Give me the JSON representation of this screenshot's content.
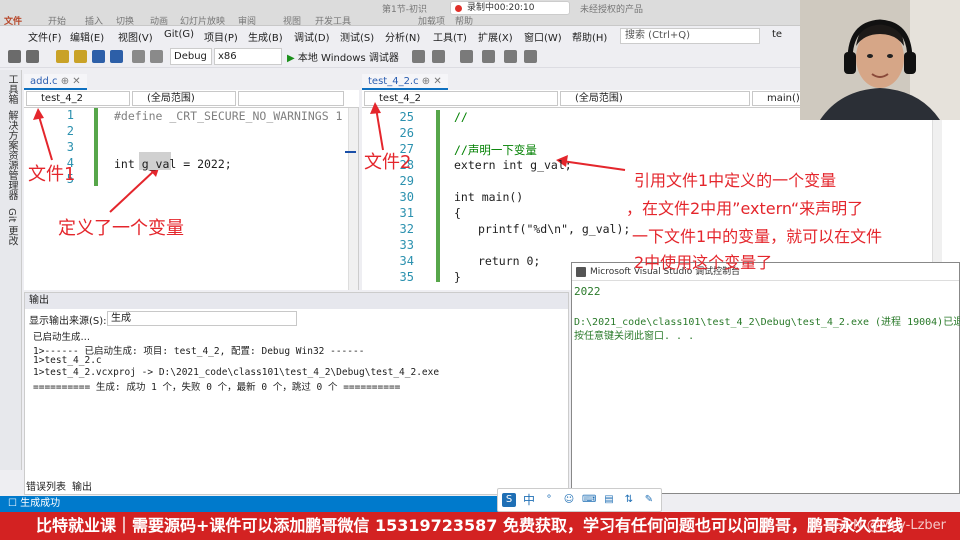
{
  "ribbon": {
    "tabs": [
      "文件",
      "开始",
      "插入",
      "切换",
      "动画",
      "幻灯片放映",
      "审阅",
      "视图",
      "开发工具",
      "加载项",
      "帮助"
    ],
    "doc_title": "第1节-初识",
    "recording": "录制中00:20:10",
    "license": "未经授权的产品"
  },
  "menubar": {
    "items": [
      "文件(F)",
      "编辑(E)",
      "视图(V)",
      "Git(G)",
      "项目(P)",
      "生成(B)",
      "调试(D)",
      "测试(S)",
      "分析(N)",
      "工具(T)",
      "扩展(X)",
      "窗口(W)",
      "帮助(H)"
    ],
    "search_placeholder": "搜索 (Ctrl+Q)",
    "solution": "te"
  },
  "toolbar": {
    "config": "Debug",
    "platform": "x86",
    "run_label": "本地 Windows 调试器"
  },
  "leftstrip": {
    "tabs": [
      "工具箱",
      "解决方案资源管理器",
      "Git 更改"
    ]
  },
  "left_editor": {
    "tab": "add.c",
    "nav_project": "test_4_2",
    "nav_scope": "(全局范围)",
    "lines": [
      {
        "n": "1",
        "code": "#define _CRT_SECURE_NO_WARNINGS 1"
      },
      {
        "n": "2",
        "code": ""
      },
      {
        "n": "3",
        "code": ""
      },
      {
        "n": "4",
        "code": "int g_val = 2022;"
      },
      {
        "n": "5",
        "code": ""
      }
    ]
  },
  "right_editor": {
    "tab": "test_4_2.c",
    "nav_project": "test_4_2",
    "nav_scope": "(全局范围)",
    "nav_func": "main()",
    "lines": [
      {
        "n": "25",
        "code": "//"
      },
      {
        "n": "26",
        "code": ""
      },
      {
        "n": "27",
        "code": "//声明一下变量"
      },
      {
        "n": "28",
        "code": "extern int g_val;"
      },
      {
        "n": "29",
        "code": ""
      },
      {
        "n": "30",
        "code": "int main()"
      },
      {
        "n": "31",
        "code": "{"
      },
      {
        "n": "32",
        "code": "printf(\"%d\\n\", g_val);"
      },
      {
        "n": "33",
        "code": ""
      },
      {
        "n": "34",
        "code": "return 0;"
      },
      {
        "n": "35",
        "code": "}"
      }
    ]
  },
  "output": {
    "title": "输出",
    "source_label": "显示输出来源(S):",
    "source_value": "生成",
    "lines": [
      "已启动生成…",
      "1>------ 已启动生成: 项目: test_4_2, 配置: Debug Win32 ------",
      "1>test_4_2.c",
      "1>test_4_2.vcxproj -> D:\\2021_code\\class101\\test_4_2\\Debug\\test_4_2.exe",
      "========== 生成: 成功 1 个，失败 0 个，最新 0 个，跳过 0 个 =========="
    ],
    "bottom_tabs": [
      "错误列表",
      "输出"
    ],
    "status": "生成成功"
  },
  "console": {
    "title": "Microsoft Visual Studio 调试控制台",
    "lines": [
      "2022",
      "",
      "D:\\2021_code\\class101\\test_4_2\\Debug\\test_4_2.exe (进程 19004)已退",
      "按任意键关闭此窗口. . ."
    ]
  },
  "ime": {
    "items": [
      "S",
      "中",
      "°",
      "☺",
      "⌨",
      "▤",
      "⇅",
      "✎"
    ]
  },
  "annotations": {
    "file1": "文件1",
    "file2": "文件2",
    "define_var": "定义了一个变量",
    "explain_1": "引用文件1中定义的一个变量",
    "explain_2": "，在文件2中用”extern“来声明了",
    "explain_3": "一下文件1中的变量，就可以在文件",
    "explain_4": "2中使用这个变量了"
  },
  "banner": {
    "text": "比特就业课｜需要源码+课件可以添加鹏哥微信 15319723587 免费获取，学习有任何问题也可以问鹏哥，鹏哥永久在线",
    "watermark": "CSDN @Mcy-Lzber"
  },
  "colors": {
    "accent": "#007acc",
    "annotation": "#e4262c",
    "banner": "#d32222",
    "keyword": "#0000ff",
    "comment": "#008000"
  }
}
